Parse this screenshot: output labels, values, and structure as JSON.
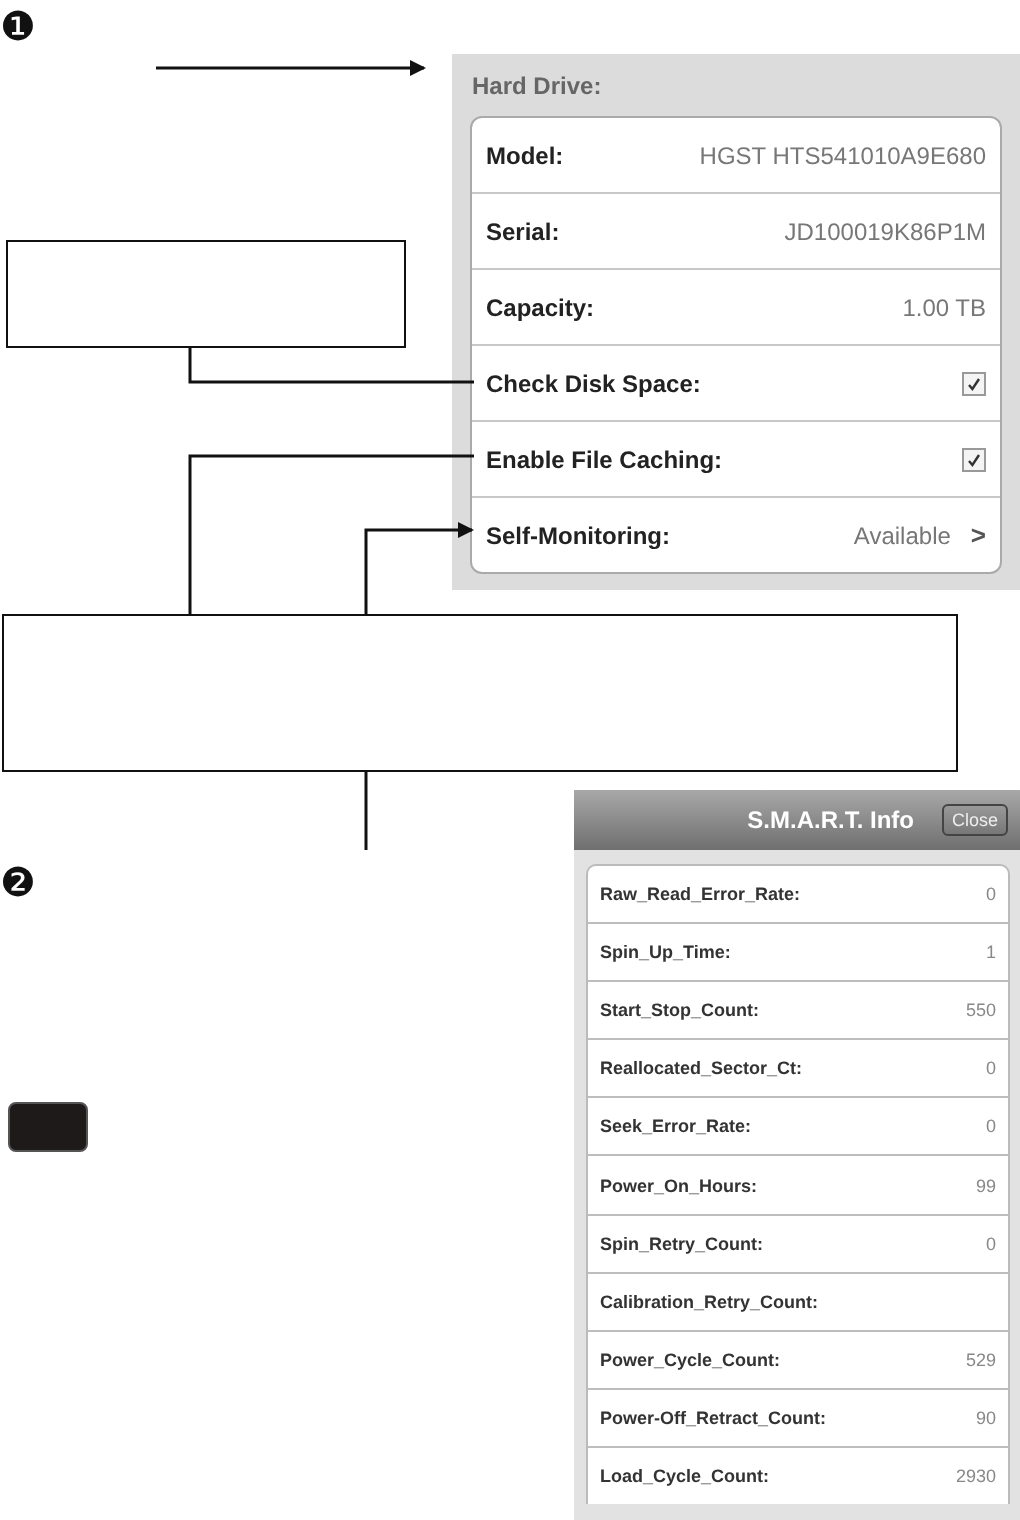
{
  "markers": [
    "❶",
    "❷"
  ],
  "hard_drive": {
    "title": "Hard Drive:",
    "rows": [
      {
        "kind": "text",
        "label": "Model:",
        "value": "HGST HTS541010A9E680"
      },
      {
        "kind": "text",
        "label": "Serial:",
        "value": "JD100019K86P1M"
      },
      {
        "kind": "text",
        "label": "Capacity:",
        "value": "1.00 TB"
      },
      {
        "kind": "checkbox",
        "label": "Check Disk Space:",
        "checked": true
      },
      {
        "kind": "checkbox",
        "label": "Enable File Caching:",
        "checked": true
      },
      {
        "kind": "link",
        "label": "Self-Monitoring:",
        "value": "Available",
        "chevron": ">"
      }
    ]
  },
  "smart_info": {
    "title": "S.M.A.R.T. Info",
    "close_button": "Close",
    "rows": [
      {
        "label": "Raw_Read_Error_Rate:",
        "value": "0"
      },
      {
        "label": "Spin_Up_Time:",
        "value": "1"
      },
      {
        "label": "Start_Stop_Count:",
        "value": "550"
      },
      {
        "label": "Reallocated_Sector_Ct:",
        "value": "0"
      },
      {
        "label": "Seek_Error_Rate:",
        "value": "0"
      },
      {
        "label": "Power_On_Hours:",
        "value": "99"
      },
      {
        "label": "Spin_Retry_Count:",
        "value": "0"
      },
      {
        "label": "Calibration_Retry_Count:"
      },
      {
        "label": "Power_Cycle_Count:",
        "value": "529"
      },
      {
        "label": "Power-Off_Retract_Count:",
        "value": "90"
      },
      {
        "label": "Load_Cycle_Count:",
        "value": "2930"
      }
    ]
  }
}
